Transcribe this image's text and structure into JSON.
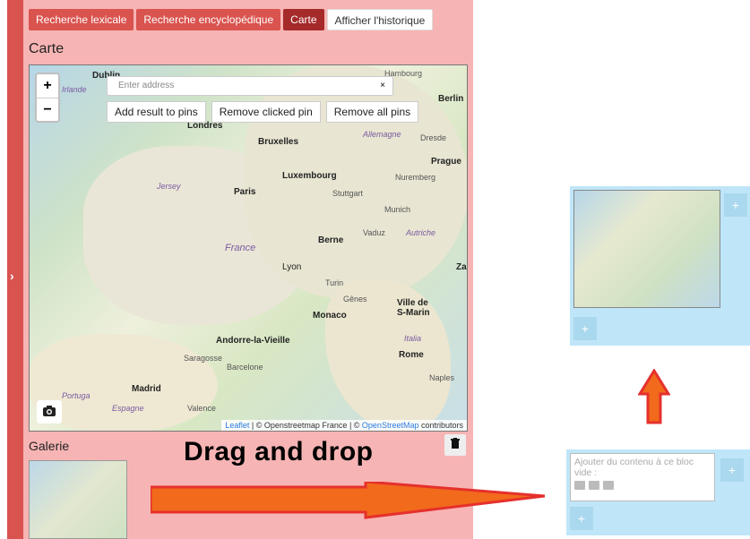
{
  "tabs": [
    {
      "label": "Recherche lexicale"
    },
    {
      "label": "Recherche encyclopédique"
    },
    {
      "label": "Carte"
    },
    {
      "label": "Afficher l'historique"
    }
  ],
  "sidebar": {
    "toggle_glyph": "›"
  },
  "map_section": {
    "title": "Carte",
    "zoom_in": "+",
    "zoom_out": "−",
    "address_placeholder": "Enter address",
    "address_clear": "×",
    "buttons": {
      "add_result": "Add result to pins",
      "remove_clicked": "Remove clicked pin",
      "remove_all": "Remove all pins"
    },
    "cities": [
      "Dublin",
      "Irlande",
      "Londres",
      "Bruxelles",
      "Luxembourg",
      "Paris",
      "Prague",
      "Nuremberg",
      "Stuttgart",
      "Munich",
      "Berne",
      "Vaduz",
      "Lyon",
      "Turin",
      "Gênes",
      "Monaco",
      "Andorre-la-Vieille",
      "Barcelone",
      "Madrid",
      "Saragosse",
      "Valence",
      "Rome",
      "Naples",
      "Hambourg",
      "Berlin",
      "Dresde",
      "Zag",
      "Jersey",
      "France",
      "Espagne",
      "Portuga",
      "Allemagne",
      "Autriche",
      "Italia",
      "Ville de S-Marin"
    ],
    "attribution": {
      "leaflet": "Leaflet",
      "sep1": " | © Openstreetmap France | © ",
      "osm": "OpenStreetMap",
      "suffix": " contributors"
    },
    "camera_icon": "camera-icon"
  },
  "gallery": {
    "title": "Galerie"
  },
  "overlay": {
    "drag_label": "Drag and drop"
  },
  "empty_block": {
    "text": "Ajouter du contenu à ce bloc vide :"
  },
  "plus": "+",
  "colors": {
    "accent": "#d9534f",
    "accent_dark": "#a52a2a",
    "panel_bg": "#f7b4b4",
    "drop_zone_bg": "#bfe6f8",
    "arrow_fill": "#f26a1b",
    "arrow_stroke": "#e5302d"
  }
}
